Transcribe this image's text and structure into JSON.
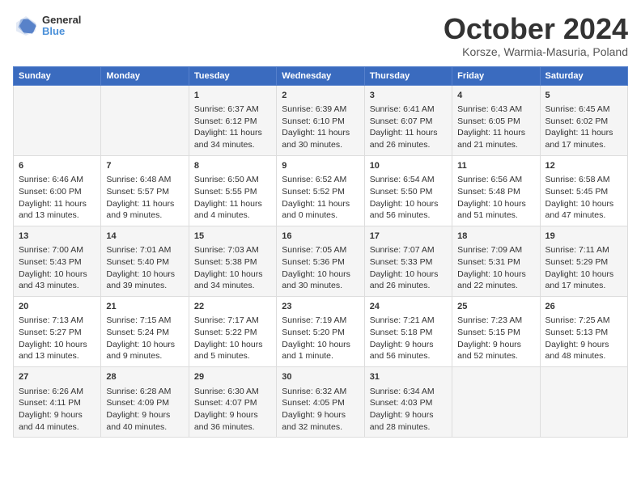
{
  "header": {
    "logo_general": "General",
    "logo_blue": "Blue",
    "month_title": "October 2024",
    "location": "Korsze, Warmia-Masuria, Poland"
  },
  "weekdays": [
    "Sunday",
    "Monday",
    "Tuesday",
    "Wednesday",
    "Thursday",
    "Friday",
    "Saturday"
  ],
  "weeks": [
    [
      {
        "day": "",
        "content": ""
      },
      {
        "day": "",
        "content": ""
      },
      {
        "day": "1",
        "content": "Sunrise: 6:37 AM\nSunset: 6:12 PM\nDaylight: 11 hours and 34 minutes."
      },
      {
        "day": "2",
        "content": "Sunrise: 6:39 AM\nSunset: 6:10 PM\nDaylight: 11 hours and 30 minutes."
      },
      {
        "day": "3",
        "content": "Sunrise: 6:41 AM\nSunset: 6:07 PM\nDaylight: 11 hours and 26 minutes."
      },
      {
        "day": "4",
        "content": "Sunrise: 6:43 AM\nSunset: 6:05 PM\nDaylight: 11 hours and 21 minutes."
      },
      {
        "day": "5",
        "content": "Sunrise: 6:45 AM\nSunset: 6:02 PM\nDaylight: 11 hours and 17 minutes."
      }
    ],
    [
      {
        "day": "6",
        "content": "Sunrise: 6:46 AM\nSunset: 6:00 PM\nDaylight: 11 hours and 13 minutes."
      },
      {
        "day": "7",
        "content": "Sunrise: 6:48 AM\nSunset: 5:57 PM\nDaylight: 11 hours and 9 minutes."
      },
      {
        "day": "8",
        "content": "Sunrise: 6:50 AM\nSunset: 5:55 PM\nDaylight: 11 hours and 4 minutes."
      },
      {
        "day": "9",
        "content": "Sunrise: 6:52 AM\nSunset: 5:52 PM\nDaylight: 11 hours and 0 minutes."
      },
      {
        "day": "10",
        "content": "Sunrise: 6:54 AM\nSunset: 5:50 PM\nDaylight: 10 hours and 56 minutes."
      },
      {
        "day": "11",
        "content": "Sunrise: 6:56 AM\nSunset: 5:48 PM\nDaylight: 10 hours and 51 minutes."
      },
      {
        "day": "12",
        "content": "Sunrise: 6:58 AM\nSunset: 5:45 PM\nDaylight: 10 hours and 47 minutes."
      }
    ],
    [
      {
        "day": "13",
        "content": "Sunrise: 7:00 AM\nSunset: 5:43 PM\nDaylight: 10 hours and 43 minutes."
      },
      {
        "day": "14",
        "content": "Sunrise: 7:01 AM\nSunset: 5:40 PM\nDaylight: 10 hours and 39 minutes."
      },
      {
        "day": "15",
        "content": "Sunrise: 7:03 AM\nSunset: 5:38 PM\nDaylight: 10 hours and 34 minutes."
      },
      {
        "day": "16",
        "content": "Sunrise: 7:05 AM\nSunset: 5:36 PM\nDaylight: 10 hours and 30 minutes."
      },
      {
        "day": "17",
        "content": "Sunrise: 7:07 AM\nSunset: 5:33 PM\nDaylight: 10 hours and 26 minutes."
      },
      {
        "day": "18",
        "content": "Sunrise: 7:09 AM\nSunset: 5:31 PM\nDaylight: 10 hours and 22 minutes."
      },
      {
        "day": "19",
        "content": "Sunrise: 7:11 AM\nSunset: 5:29 PM\nDaylight: 10 hours and 17 minutes."
      }
    ],
    [
      {
        "day": "20",
        "content": "Sunrise: 7:13 AM\nSunset: 5:27 PM\nDaylight: 10 hours and 13 minutes."
      },
      {
        "day": "21",
        "content": "Sunrise: 7:15 AM\nSunset: 5:24 PM\nDaylight: 10 hours and 9 minutes."
      },
      {
        "day": "22",
        "content": "Sunrise: 7:17 AM\nSunset: 5:22 PM\nDaylight: 10 hours and 5 minutes."
      },
      {
        "day": "23",
        "content": "Sunrise: 7:19 AM\nSunset: 5:20 PM\nDaylight: 10 hours and 1 minute."
      },
      {
        "day": "24",
        "content": "Sunrise: 7:21 AM\nSunset: 5:18 PM\nDaylight: 9 hours and 56 minutes."
      },
      {
        "day": "25",
        "content": "Sunrise: 7:23 AM\nSunset: 5:15 PM\nDaylight: 9 hours and 52 minutes."
      },
      {
        "day": "26",
        "content": "Sunrise: 7:25 AM\nSunset: 5:13 PM\nDaylight: 9 hours and 48 minutes."
      }
    ],
    [
      {
        "day": "27",
        "content": "Sunrise: 6:26 AM\nSunset: 4:11 PM\nDaylight: 9 hours and 44 minutes."
      },
      {
        "day": "28",
        "content": "Sunrise: 6:28 AM\nSunset: 4:09 PM\nDaylight: 9 hours and 40 minutes."
      },
      {
        "day": "29",
        "content": "Sunrise: 6:30 AM\nSunset: 4:07 PM\nDaylight: 9 hours and 36 minutes."
      },
      {
        "day": "30",
        "content": "Sunrise: 6:32 AM\nSunset: 4:05 PM\nDaylight: 9 hours and 32 minutes."
      },
      {
        "day": "31",
        "content": "Sunrise: 6:34 AM\nSunset: 4:03 PM\nDaylight: 9 hours and 28 minutes."
      },
      {
        "day": "",
        "content": ""
      },
      {
        "day": "",
        "content": ""
      }
    ]
  ]
}
